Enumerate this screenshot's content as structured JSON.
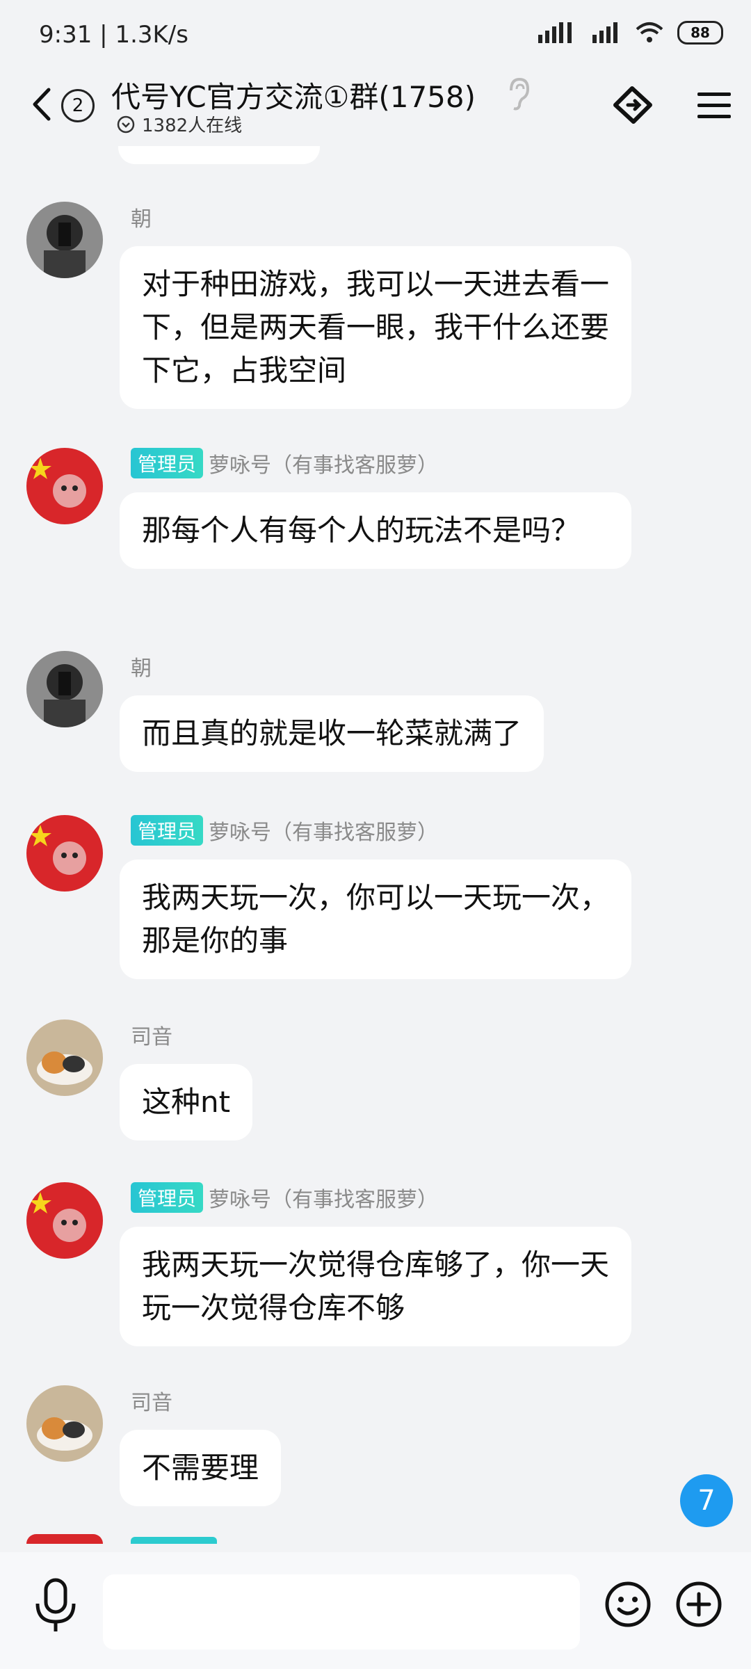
{
  "status_bar": {
    "time": "9:31",
    "speed": "1.3K/s",
    "battery": "88"
  },
  "header": {
    "unread_count": "2",
    "group_title": "代号YC官方交流①群(1758)",
    "online_text": "1382人在线"
  },
  "messages": [
    {
      "sender": "朝",
      "admin": false,
      "text": "对于种田游戏，我可以一天进去看一下，但是两天看一眼，我干什么还要下它，占我空间"
    },
    {
      "sender": "萝咏号（有事找客服萝）",
      "admin": true,
      "admin_label": "管理员",
      "text": "那每个人有每个人的玩法不是吗？"
    },
    {
      "sender": "朝",
      "admin": false,
      "text": "而且真的就是收一轮菜就满了"
    },
    {
      "sender": "萝咏号（有事找客服萝）",
      "admin": true,
      "admin_label": "管理员",
      "text": "我两天玩一次，你可以一天玩一次，那是你的事"
    },
    {
      "sender": "司音",
      "admin": false,
      "text": "这种nt"
    },
    {
      "sender": "萝咏号（有事找客服萝）",
      "admin": true,
      "admin_label": "管理员",
      "text": "我两天玩一次觉得仓库够了，你一天玩一次觉得仓库不够"
    },
    {
      "sender": "司音",
      "admin": false,
      "text": "不需要理"
    }
  ],
  "floating_unread": "7",
  "input": {
    "placeholder": ""
  },
  "colors": {
    "background": "#f2f3f5",
    "bubble": "#ffffff",
    "admin_badge": "#2ccbcf",
    "unread_badge": "#1e9bf0"
  }
}
